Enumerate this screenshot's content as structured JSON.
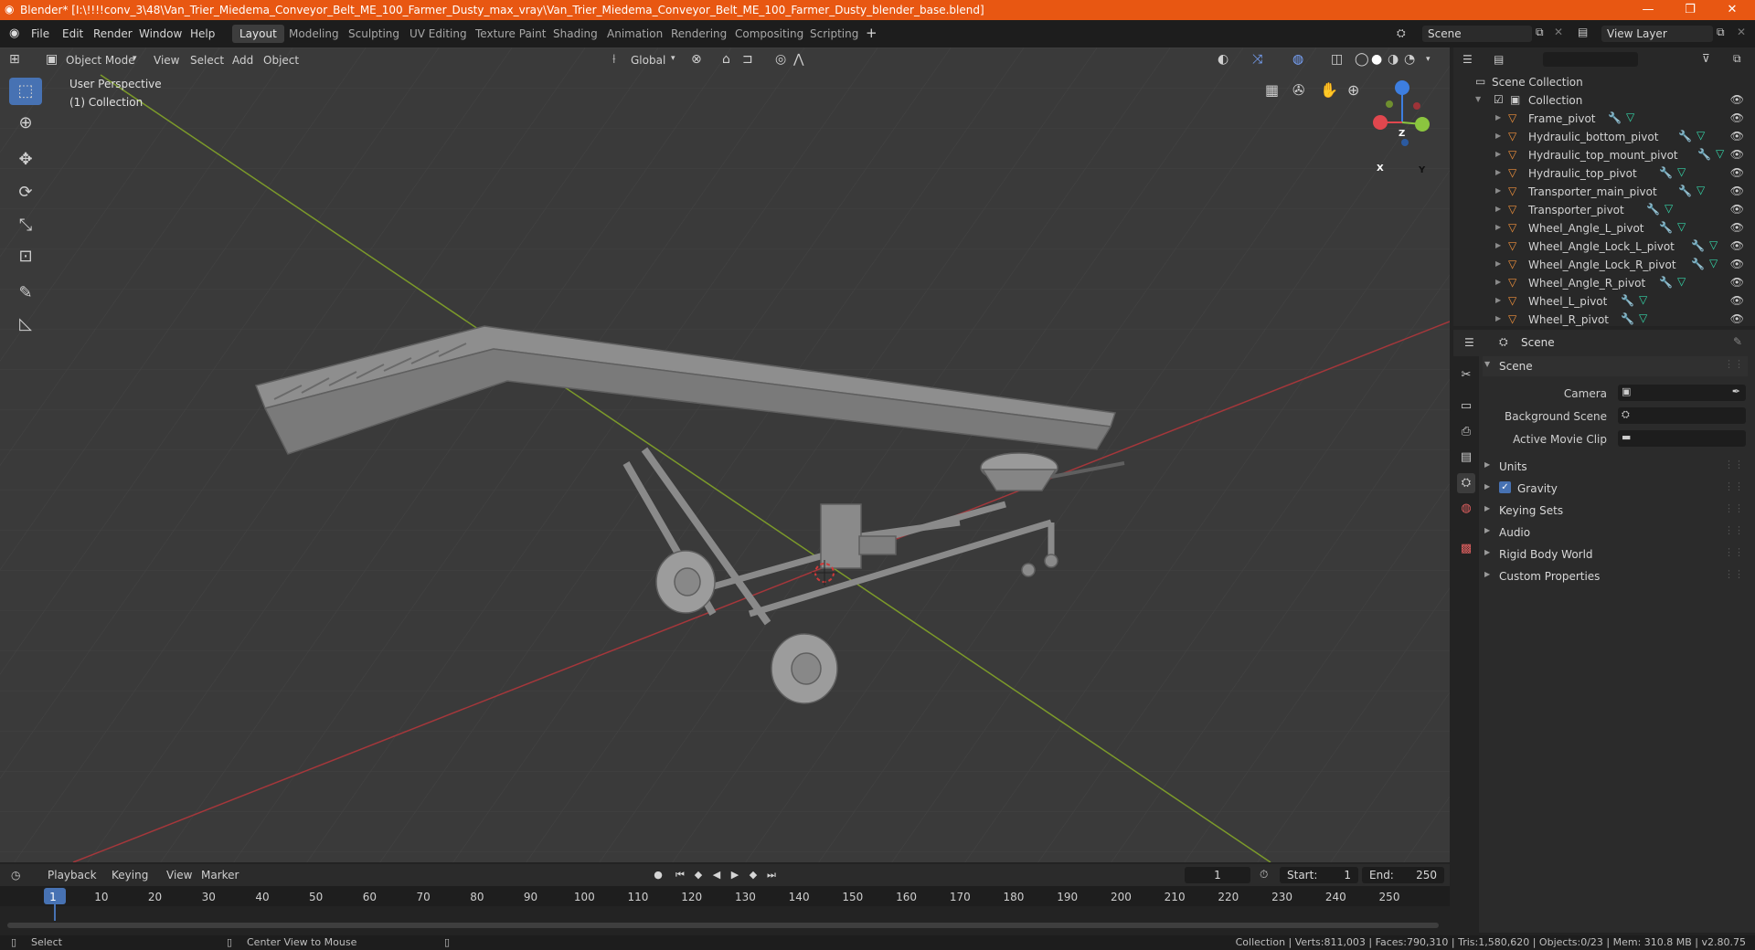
{
  "window": {
    "title": "Blender* [I:\\!!!!conv_3\\48\\Van_Trier_Miedema_Conveyor_Belt_ME_100_Farmer_Dusty_max_vray\\Van_Trier_Miedema_Conveyor_Belt_ME_100_Farmer_Dusty_blender_base.blend]",
    "minimize": "—",
    "maximize": "❐",
    "close": "✕"
  },
  "menu": [
    "File",
    "Edit",
    "Render",
    "Window",
    "Help"
  ],
  "workspaces": [
    "Layout",
    "Modeling",
    "Sculpting",
    "UV Editing",
    "Texture Paint",
    "Shading",
    "Animation",
    "Rendering",
    "Compositing",
    "Scripting"
  ],
  "add_workspace": "+",
  "scene_selector": "Scene",
  "view_layer": "View Layer",
  "viewport": {
    "mode": "Object Mode",
    "menus": [
      "View",
      "Select",
      "Add",
      "Object"
    ],
    "orientation": "Global",
    "info_line1": "User Perspective",
    "info_line2": "(1) Collection",
    "gizmo": {
      "z": "Z",
      "y": "Y",
      "x": "X"
    }
  },
  "outliner": {
    "search_placeholder": "",
    "root": "Scene Collection",
    "collection": "Collection",
    "items": [
      "Frame_pivot",
      "Hydraulic_bottom_pivot",
      "Hydraulic_top_mount_pivot",
      "Hydraulic_top_pivot",
      "Transporter_main_pivot",
      "Transporter_pivot",
      "Wheel_Angle_L_pivot",
      "Wheel_Angle_Lock_L_pivot",
      "Wheel_Angle_Lock_R_pivot",
      "Wheel_Angle_R_pivot",
      "Wheel_L_pivot",
      "Wheel_R_pivot"
    ]
  },
  "properties": {
    "context": "Scene",
    "panel_title": "Scene",
    "camera_label": "Camera",
    "background_scene_label": "Background Scene",
    "active_movie_clip_label": "Active Movie Clip",
    "panels": [
      "Units",
      "Gravity",
      "Keying Sets",
      "Audio",
      "Rigid Body World",
      "Custom Properties"
    ],
    "gravity_checked": true
  },
  "timeline": {
    "menus": [
      "Playback",
      "Keying",
      "View",
      "Marker"
    ],
    "current_frame": "1",
    "start_label": "Start:",
    "start": "1",
    "end_label": "End:",
    "end": "250",
    "ticks": [
      "1",
      "10",
      "20",
      "30",
      "40",
      "50",
      "60",
      "70",
      "80",
      "90",
      "100",
      "110",
      "120",
      "130",
      "140",
      "150",
      "160",
      "170",
      "180",
      "190",
      "200",
      "210",
      "220",
      "230",
      "240",
      "250"
    ]
  },
  "statusbar": {
    "select": "Select",
    "center_view": "Center View to Mouse",
    "stats": "Collection | Verts:811,003 | Faces:790,310 | Tris:1,580,620 | Objects:0/23 | Mem: 310.8 MB | v2.80.75"
  },
  "colors": {
    "titlebar": "#e85712",
    "accent": "#4772b3",
    "x_axis": "#e0474e",
    "y_axis": "#8bc53f",
    "z_axis": "#3d7ee0"
  }
}
